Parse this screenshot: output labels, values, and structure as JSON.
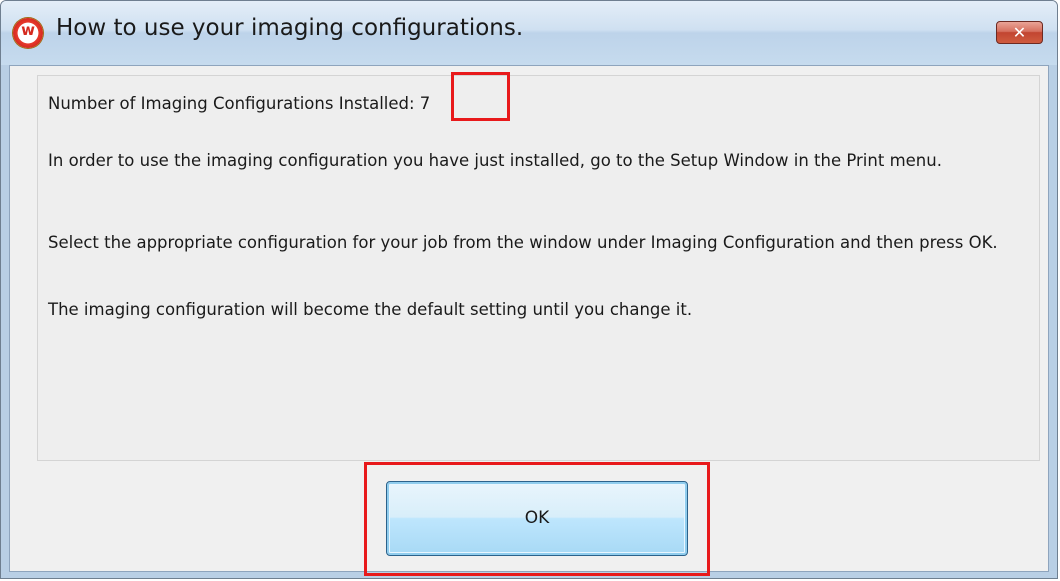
{
  "window": {
    "title": "How to use your imaging configurations.",
    "app_icon": "app-logo-icon",
    "app_icon_letter": "w",
    "close_glyph": "✕"
  },
  "message": {
    "installed_line": "Number of Imaging Configurations Installed: 7",
    "paragraph_1": "In order to use the imaging configuration you have just installed, go to the Setup Window in the Print menu.",
    "paragraph_2": "Select the appropriate configuration for your job from the window under Imaging Configuration and then press OK.",
    "paragraph_3": "The imaging configuration will become the default setting until you change it."
  },
  "buttons": {
    "ok_label": "OK"
  },
  "colors": {
    "highlight": "#e8191b",
    "close_button": "#c24531",
    "ok_button": "#bee6fd"
  }
}
